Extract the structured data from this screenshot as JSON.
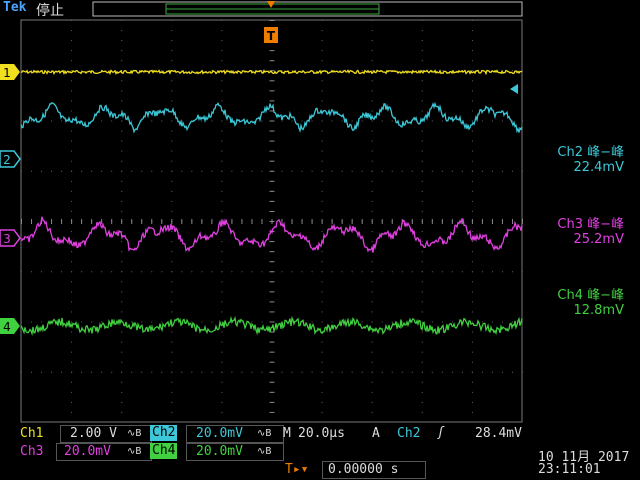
{
  "header": {
    "brand": "Tek",
    "run_state": "停止"
  },
  "markers": {
    "trigger_position": "T",
    "ch1": "1",
    "ch2": "2",
    "ch3": "3",
    "ch4": "4"
  },
  "measurements": [
    {
      "label": "Ch2 峰−峰",
      "value": "22.4mV",
      "color": "#3cc8d8"
    },
    {
      "label": "Ch3 峰−峰",
      "value": "25.2mV",
      "color": "#e040e0"
    },
    {
      "label": "Ch4 峰−峰",
      "value": "12.8mV",
      "color": "#40d040"
    }
  ],
  "channels": {
    "ch1": {
      "name": "Ch1",
      "scale": "2.00 V",
      "color": "#f0e020"
    },
    "ch2": {
      "name": "Ch2",
      "scale": "20.0mV",
      "color": "#3cc8d8"
    },
    "ch3": {
      "name": "Ch3",
      "scale": "20.0mV",
      "color": "#e040e0"
    },
    "ch4": {
      "name": "Ch4",
      "scale": "20.0mV",
      "color": "#40d040"
    }
  },
  "coupling_symbol": "∿B",
  "timebase": {
    "label": "M",
    "value": "20.0µs"
  },
  "trigger": {
    "label": "A",
    "source": "Ch2",
    "slope": "ʃ",
    "level": "28.4mV"
  },
  "horizontal_position": {
    "icon": "T▸▾",
    "value": "0.00000 s"
  },
  "datetime": {
    "date": "10 11月 2017",
    "time": "23:11:01"
  }
}
